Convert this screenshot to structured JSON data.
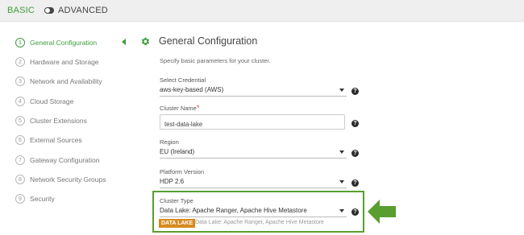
{
  "topbar": {
    "basic_label": "BASIC",
    "advanced_label": "ADVANCED"
  },
  "sidebar": {
    "steps": [
      {
        "num": "1",
        "label": "General Configuration"
      },
      {
        "num": "2",
        "label": "Hardware and Storage"
      },
      {
        "num": "3",
        "label": "Network and Availability"
      },
      {
        "num": "4",
        "label": "Cloud Storage"
      },
      {
        "num": "5",
        "label": "Cluster Extensions"
      },
      {
        "num": "6",
        "label": "External Sources"
      },
      {
        "num": "7",
        "label": "Gateway Configuration"
      },
      {
        "num": "8",
        "label": "Network Security Groups"
      },
      {
        "num": "9",
        "label": "Security"
      }
    ]
  },
  "main": {
    "title": "General Configuration",
    "subtitle": "Specify basic parameters for your cluster.",
    "credential": {
      "label": "Select Credential",
      "value": "aws-key-based (AWS)"
    },
    "cluster_name": {
      "label": "Cluster Name",
      "required_mark": "*",
      "value": "test-data-lake"
    },
    "region": {
      "label": "Region",
      "value": "EU (Ireland)"
    },
    "platform_version": {
      "label": "Platform Version",
      "value": "HDP 2.6"
    },
    "cluster_type": {
      "label": "Cluster Type",
      "value": "Data Lake: Apache Ranger, Apache Hive Metastore",
      "badge": "DATA LAKE",
      "badge_description": "Data Lake: Apache Ranger, Apache Hive Metastore"
    },
    "help_glyph": "?"
  },
  "colors": {
    "accent_green": "#3d9c3d",
    "highlight_green": "#5a9e2f",
    "badge_orange": "#d88a1e"
  },
  "icons": {
    "title_icon": "gear-icon",
    "help_icon": "question-circle-icon",
    "pointer": "arrow-left-icon"
  }
}
